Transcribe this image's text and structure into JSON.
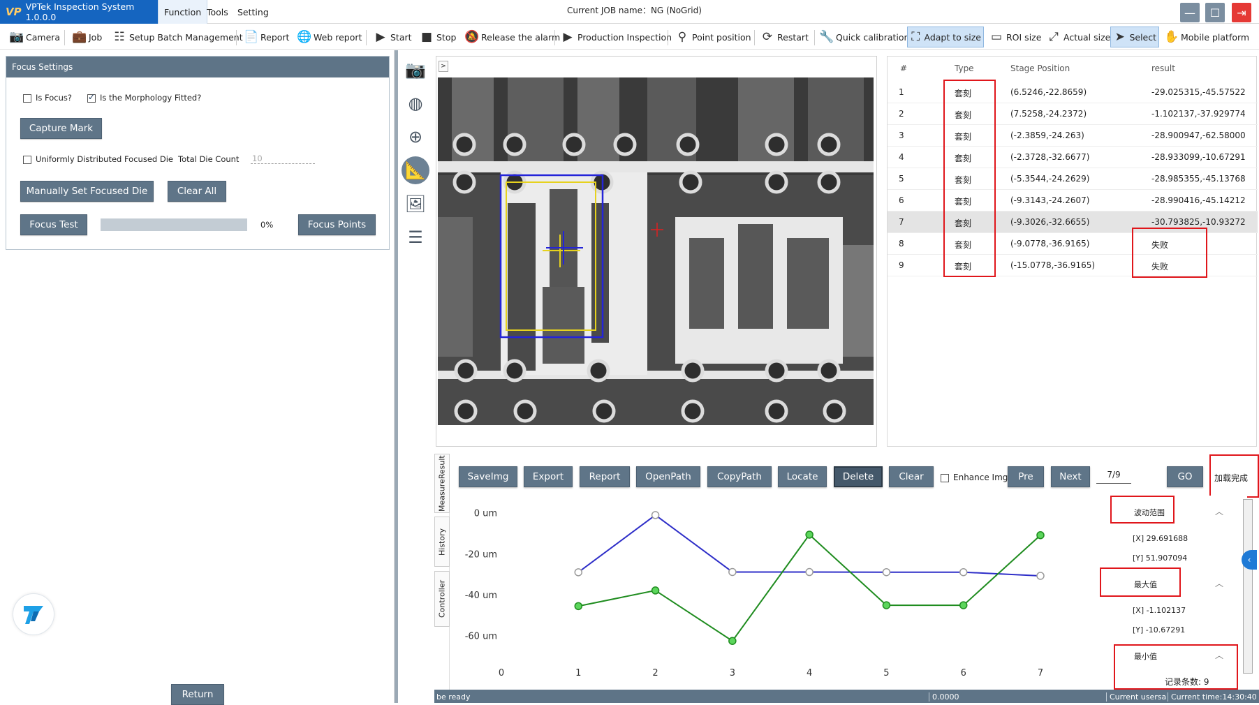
{
  "app": {
    "title": "VPTek Inspection System 1.0.0.0",
    "logo": "VP"
  },
  "menu": [
    "Function",
    "Tools",
    "Setting"
  ],
  "job_label": "Current JOB name：NG (NoGrid)",
  "toolbar": [
    {
      "label": "Camera",
      "icon": "camera-icon"
    },
    {
      "label": "Job",
      "icon": "briefcase-icon"
    },
    {
      "label": "Setup Batch Management",
      "icon": "checklist-icon"
    },
    {
      "label": "Report",
      "icon": "document-icon"
    },
    {
      "label": "Web report",
      "icon": "globe-icon"
    },
    {
      "label": "Start",
      "icon": "play-icon"
    },
    {
      "label": "Stop",
      "icon": "stop-icon"
    },
    {
      "label": "Release the alarm",
      "icon": "bell-off-icon"
    },
    {
      "label": "Production Inspection",
      "icon": "play-icon"
    },
    {
      "label": "Point position",
      "icon": "pin-icon"
    },
    {
      "label": "Restart",
      "icon": "restart-icon"
    },
    {
      "label": "Quick calibration",
      "icon": "wrench-icon"
    },
    {
      "label": "Adapt to size",
      "icon": "fit-icon"
    },
    {
      "label": "ROI size",
      "icon": "rect-icon"
    },
    {
      "label": "Actual size",
      "icon": "expand-icon"
    },
    {
      "label": "Select",
      "icon": "cursor-icon"
    },
    {
      "label": "Mobile platform",
      "icon": "hand-icon"
    }
  ],
  "focus": {
    "header": "Focus Settings",
    "is_focus": "Is Focus?",
    "morph": "Is the Morphology Fitted?",
    "capture_mark": "Capture Mark",
    "uniform": "Uniformly Distributed Focused Die",
    "total_die_label": "Total Die Count",
    "total_die_value": "10",
    "manual_set": "Manually Set Focused Die",
    "clear_all": "Clear All",
    "focus_test": "Focus Test",
    "progress": "0%",
    "progress_value": 0,
    "focus_points": "Focus Points",
    "return": "Return"
  },
  "results": {
    "headers": [
      "#",
      "Type",
      "Stage Position",
      "result"
    ],
    "rows": [
      {
        "n": "1",
        "type": "套刻",
        "pos": "(6.5246,-22.8659)",
        "res": "-29.025315,-45.57522"
      },
      {
        "n": "2",
        "type": "套刻",
        "pos": "(7.5258,-24.2372)",
        "res": "-1.102137,-37.929774"
      },
      {
        "n": "3",
        "type": "套刻",
        "pos": "(-2.3859,-24.263)",
        "res": "-28.900947,-62.58000"
      },
      {
        "n": "4",
        "type": "套刻",
        "pos": "(-2.3728,-32.6677)",
        "res": "-28.933099,-10.67291"
      },
      {
        "n": "5",
        "type": "套刻",
        "pos": "(-5.3544,-24.2629)",
        "res": "-28.985355,-45.13768"
      },
      {
        "n": "6",
        "type": "套刻",
        "pos": "(-9.3143,-24.2607)",
        "res": "-28.990416,-45.14212"
      },
      {
        "n": "7",
        "type": "套刻",
        "pos": "(-9.3026,-32.6655)",
        "res": "-30.793825,-10.93272"
      },
      {
        "n": "8",
        "type": "套刻",
        "pos": "(-9.0778,-36.9165)",
        "res": "失败"
      },
      {
        "n": "9",
        "type": "套刻",
        "pos": "(-15.0778,-36.9165)",
        "res": "失败"
      }
    ]
  },
  "bottom": {
    "tabs": [
      "MeasureResult",
      "History",
      "Controller"
    ],
    "buttons": [
      "SaveImg",
      "Export",
      "Report",
      "OpenPath",
      "CopyPath",
      "Locate",
      "Delete",
      "Clear"
    ],
    "enhance": "Enhance Img",
    "pre": "Pre",
    "next": "Next",
    "page": "7/9",
    "go": "GO",
    "loaded": "加载完成"
  },
  "stats": {
    "range_title": "波动范围",
    "range_x": "[X]   29.691688",
    "range_y": "[Y]   51.907094",
    "max_title": "最大值",
    "max_x": "[X]   -1.102137",
    "max_y": "[Y]   -10.67291",
    "min_title": "最小值",
    "count": "记录条数: 9"
  },
  "status": {
    "left": "be ready",
    "mid": "0.0000",
    "user": "Current usersa",
    "time": "Current time:14:30:40"
  },
  "chart_data": {
    "type": "line",
    "x": [
      0,
      1,
      2,
      3,
      4,
      5,
      6,
      7
    ],
    "xticks": [
      "0",
      "1",
      "2",
      "3",
      "4",
      "5",
      "6",
      "7"
    ],
    "yticks": [
      "0 um",
      "-20 um",
      "-40 um",
      "-60 um"
    ],
    "ylim": [
      -70,
      5
    ],
    "xlim": [
      0,
      7
    ],
    "series": [
      {
        "color": "#2e2ec8",
        "x": [
          1,
          2,
          3,
          4,
          5,
          6,
          7
        ],
        "values": [
          -29.03,
          -1.1,
          -28.9,
          -28.93,
          -28.99,
          -28.99,
          -30.79
        ]
      },
      {
        "color": "#1f8c1f",
        "x": [
          1,
          2,
          3,
          4,
          5,
          6,
          7
        ],
        "values": [
          -45.58,
          -37.93,
          -62.58,
          -10.67,
          -45.14,
          -45.14,
          -10.93
        ]
      }
    ]
  }
}
